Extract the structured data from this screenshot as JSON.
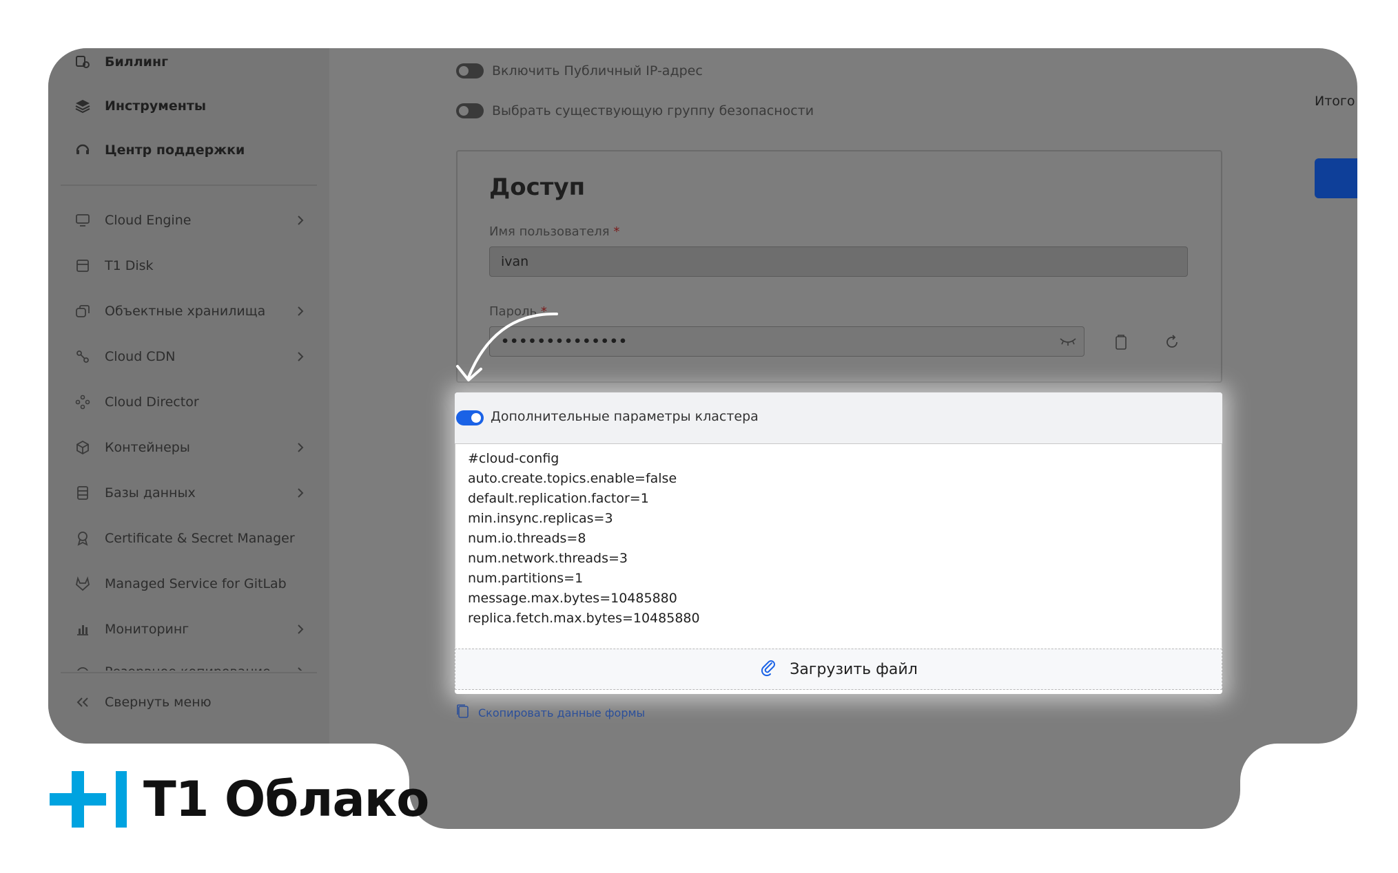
{
  "sidebar": {
    "top_items": [
      {
        "label": "Биллинг",
        "icon": "billing-icon"
      },
      {
        "label": "Инструменты",
        "icon": "layers-icon"
      },
      {
        "label": "Центр поддержки",
        "icon": "support-icon"
      }
    ],
    "items": [
      {
        "label": "Cloud Engine",
        "icon": "monitor-icon",
        "has_submenu": true
      },
      {
        "label": "T1 Disk",
        "icon": "disk-icon",
        "has_submenu": false
      },
      {
        "label": "Объектные хранилища",
        "icon": "storage-icon",
        "has_submenu": true
      },
      {
        "label": "Cloud CDN",
        "icon": "cdn-icon",
        "has_submenu": true
      },
      {
        "label": "Cloud Director",
        "icon": "director-icon",
        "has_submenu": false
      },
      {
        "label": "Контейнеры",
        "icon": "container-icon",
        "has_submenu": true
      },
      {
        "label": "Базы данных",
        "icon": "database-icon",
        "has_submenu": true
      },
      {
        "label": "Certificate & Secret Manager",
        "icon": "certificate-icon",
        "has_submenu": false
      },
      {
        "label": "Managed Service for GitLab",
        "icon": "gitlab-icon",
        "has_submenu": false
      },
      {
        "label": "Мониторинг",
        "icon": "chart-icon",
        "has_submenu": true
      },
      {
        "label": "Резервное копирование",
        "icon": "backup-icon",
        "has_submenu": true
      }
    ],
    "collapse_label": "Свернуть меню"
  },
  "network": {
    "public_ip_label": "Включить Публичный IP-адрес",
    "security_group_label": "Выбрать существующую группу безопасности"
  },
  "access": {
    "title": "Доступ",
    "username_label": "Имя пользователя",
    "username_value": "ivan",
    "password_label": "Пароль",
    "password_value": "••••••••••••••",
    "required_mark": "*"
  },
  "cluster_params": {
    "toggle_label": "Дополнительные параметры кластера",
    "config_lines": [
      "#cloud-config",
      "auto.create.topics.enable=false",
      "default.replication.factor=1",
      "min.insync.replicas=3",
      "num.io.threads=8",
      "num.network.threads=3",
      "num.partitions=1",
      "message.max.bytes=10485880",
      "replica.fetch.max.bytes=10485880"
    ],
    "upload_label": "Загрузить файл"
  },
  "copy_form_label": "Скопировать данные формы",
  "summary": {
    "total_label": "Итого"
  },
  "brand": {
    "name": "T1 Облако",
    "accent_color": "#00a3e0"
  },
  "colors": {
    "toggle_on": "#1a62e6",
    "link": "#2b4f9a",
    "primary_button": "#0e3f99"
  }
}
